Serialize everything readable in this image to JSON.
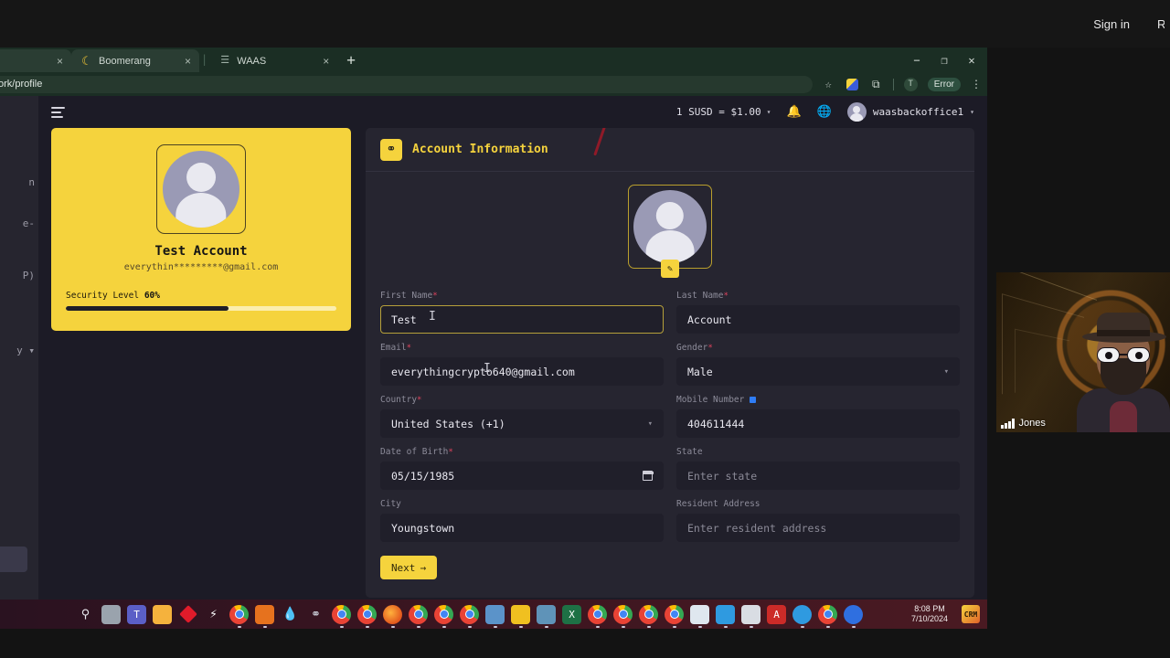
{
  "os": {
    "signin_label": "Sign in",
    "cut_button_label": "R"
  },
  "browser": {
    "tabs": [
      {
        "title": "",
        "favicon": "blank-favicon",
        "close": "×",
        "active": false,
        "cut": true
      },
      {
        "title": "Boomerang",
        "favicon": "boomerang-favicon",
        "close": "×",
        "active": true,
        "cut": false
      },
      {
        "title": "WAAS",
        "favicon": "waas-favicon",
        "close": "×",
        "active": false,
        "cut": false
      }
    ],
    "new_tab_label": "+",
    "window_controls": {
      "minimize": "−",
      "maximize": "❐",
      "close": "✕"
    },
    "url": "aas.network/profile",
    "omnibox_icons": {
      "bookmark": "☆",
      "extension": "extension-puzzle-icon",
      "split": "⧉",
      "profile_initial": "T",
      "error_label": "Error",
      "menu": "⋮"
    }
  },
  "app": {
    "sidebar_fragments": [
      "n",
      "e-",
      "P)",
      "y ▾"
    ],
    "topbar": {
      "menu_icon": "hamburger-icon",
      "exchange_rate": "1 SUSD = $1.00",
      "caret": "⌄",
      "bell_icon": "ὑ4",
      "globe_icon": "⊕",
      "username": "waasbackoffice1",
      "user_caret": "▾"
    },
    "profile_card": {
      "name": "Test Account",
      "email": "everythin*********@gmail.com",
      "security_label": "Security Level",
      "security_percent_text": "60%",
      "security_percent": 60,
      "bg_color": "#f5d33d"
    },
    "form": {
      "header_title": "Account Information",
      "header_icon": "user-icon",
      "avatar_edit_icon": "pencil-icon",
      "accent_color": "#f5d33d",
      "fields": [
        {
          "label": "First Name",
          "required": "*",
          "required_color": "red",
          "value": "Test",
          "placeholder": "",
          "type": "text",
          "focused": true
        },
        {
          "label": "Last Name",
          "required": "*",
          "required_color": "red",
          "value": "Account",
          "placeholder": "",
          "type": "text",
          "focused": false
        },
        {
          "label": "Email",
          "required": "*",
          "required_color": "red",
          "value": "everythingcrypto640@gmail.com",
          "placeholder": "",
          "type": "text",
          "focused": false
        },
        {
          "label": "Gender",
          "required": "*",
          "required_color": "red",
          "value": "Male",
          "placeholder": "",
          "type": "select",
          "focused": false
        },
        {
          "label": "Country",
          "required": "*",
          "required_color": "red",
          "value": "United States (+1)",
          "placeholder": "",
          "type": "select",
          "focused": false
        },
        {
          "label": "Mobile Number",
          "required": "*",
          "required_color": "blue",
          "value": "404611444",
          "placeholder": "",
          "type": "text",
          "focused": false
        },
        {
          "label": "Date of Birth",
          "required": "*",
          "required_color": "red",
          "value": "05/15/1985",
          "placeholder": "",
          "type": "date",
          "focused": false
        },
        {
          "label": "State",
          "required": "",
          "required_color": "",
          "value": "",
          "placeholder": "Enter state",
          "type": "text",
          "focused": false
        },
        {
          "label": "City",
          "required": "",
          "required_color": "",
          "value": "Youngstown",
          "placeholder": "",
          "type": "text",
          "focused": false
        },
        {
          "label": "Resident Address",
          "required": "",
          "required_color": "",
          "value": "",
          "placeholder": "Enter resident address",
          "type": "text",
          "focused": false
        }
      ],
      "next_button": {
        "label": "Next",
        "arrow": "→"
      }
    }
  },
  "video_tile": {
    "participant_name": "Jones",
    "signal_icon": "signal-bars-icon"
  },
  "taskbar": {
    "clock_time": "8:08 PM",
    "clock_date": "7/10/2024",
    "tray_label": "CRM"
  }
}
